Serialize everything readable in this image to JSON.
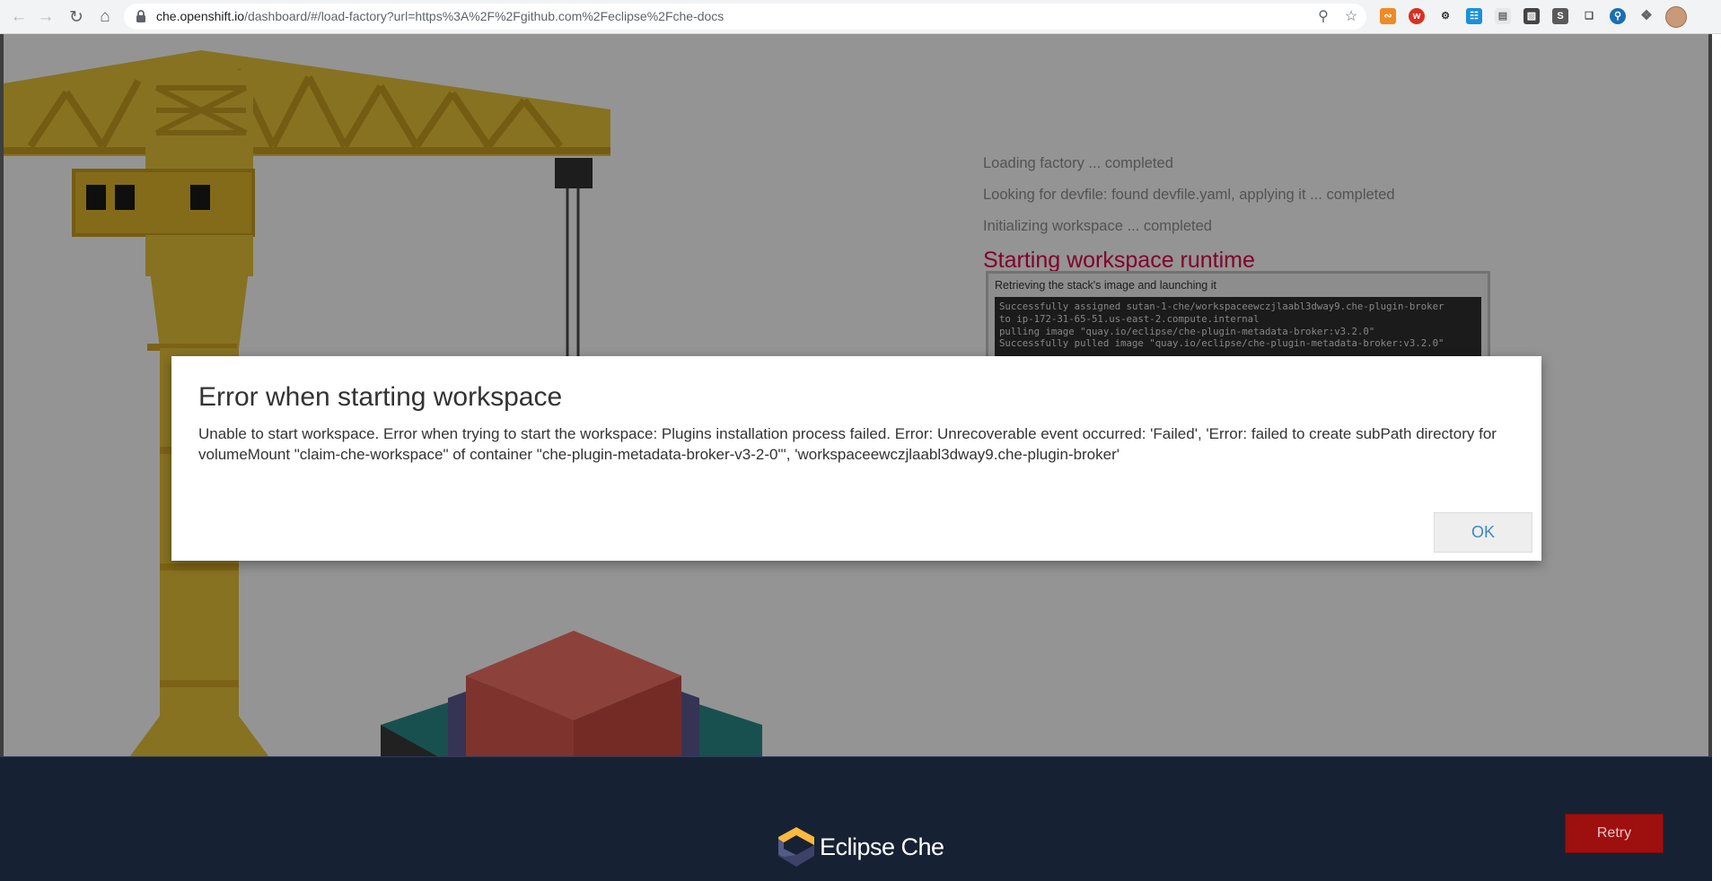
{
  "browser": {
    "url_host": "che.openshift.io",
    "url_path": "/dashboard/#/load-factory?url=https%3A%2F%2Fgithub.com%2Feclipse%2Fche-docs",
    "icons": [
      "back-icon",
      "forward-icon",
      "reload-icon",
      "home-icon",
      "lock-icon",
      "zoom-icon",
      "star-icon",
      "extensions-icon",
      "profile-avatar"
    ]
  },
  "progress": {
    "steps": [
      "Loading factory ... completed",
      "Looking for devfile: found devfile.yaml, applying it ... completed",
      "Initializing workspace ... completed"
    ],
    "current_step": "Starting workspace runtime",
    "log_title": "Retrieving the stack's image and launching it",
    "log_lines": [
      "Successfully assigned sutan-1-che/workspaceewczjlaabl3dway9.che-plugin-broker",
      "to ip-172-31-65-51.us-east-2.compute.internal",
      "pulling image \"quay.io/eclipse/che-plugin-metadata-broker:v3.2.0\"",
      "Successfully pulled image \"quay.io/eclipse/che-plugin-metadata-broker:v3.2.0\""
    ]
  },
  "dialog": {
    "title": "Error when starting workspace",
    "message": "Unable to start workspace. Error when trying to start the workspace: Plugins installation process failed. Error: Unrecoverable event occurred: 'Failed', 'Error: failed to create subPath directory for volumeMount \"claim-che-workspace\" of container \"che-plugin-metadata-broker-v3-2-0\"', 'workspaceewczjlaabl3dway9.che-plugin-broker'",
    "ok_label": "OK"
  },
  "footer": {
    "brand": "Eclipse Che",
    "retry_label": "Retry"
  },
  "colors": {
    "current_step": "#e0004d",
    "retry_bg": "#9e0f0f",
    "footer_bg": "#162233",
    "ok_text": "#3f87c9"
  }
}
